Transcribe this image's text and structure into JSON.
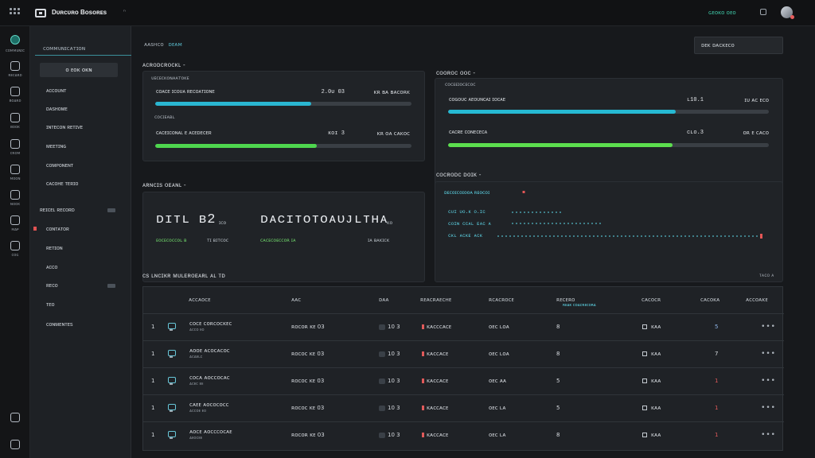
{
  "topbar": {
    "app_title": "Dᴜʀᴄᴜʀᴏ Bᴏsᴏʀᴇs",
    "badge": "ⁿ",
    "status": "ɢᴇᴏᴋᴏ ᴏᴇᴏ",
    "icons": [
      "grid-icon",
      "app-logo",
      "status-icon",
      "avatar"
    ]
  },
  "rail": {
    "items": [
      {
        "label": "ᴄᴏᴍᴍᴜɴɪᴄ",
        "icon": "activity-icon"
      },
      {
        "label": "ʀᴇᴄᴀʀᴅ",
        "icon": "circle-icon"
      },
      {
        "label": "ʙᴏᴀʀᴅ",
        "icon": "board-icon"
      },
      {
        "label": "ʙᴏᴏᴋ",
        "icon": "book-icon"
      },
      {
        "label": "ᴄʀᴏᴍ",
        "icon": "crown-icon"
      },
      {
        "label": "ᴍᴏᴏɴ",
        "icon": "moon-icon"
      },
      {
        "label": "ɴᴏᴏᴋ",
        "icon": "note-icon"
      },
      {
        "label": "ᴍᴀᴘ",
        "icon": "map-icon"
      },
      {
        "label": "ᴄᴏɢ",
        "icon": "gear-icon"
      }
    ],
    "bottom": [
      "terminal-icon",
      "settings-icon"
    ]
  },
  "sidebar": {
    "header": "ᴄᴏᴍᴍᴜɴɪᴄᴀᴛɪᴏɴ",
    "button": "ᴏ ᴇᴏᴋ ᴏᴋɴ",
    "items": [
      "ᴀᴄᴄᴏᴜɴᴛ",
      "ᴅᴀsʜᴏᴍᴇ",
      "ɪɴᴛᴇᴄᴏɴ ʀᴇᴛɪᴠᴇ",
      "ᴍᴇᴇᴛɪɴɢ",
      "ᴄᴏᴍᴘᴏɴᴇɴᴛ",
      "ᴄᴀᴄᴏʜᴇ ᴛᴇʀɪᴏ",
      "ʀᴇɪᴄᴇʟ ʀᴇᴄᴏʀᴅ",
      "ᴄᴏɴᴛᴀᴛᴏʀ",
      "ʀᴇᴛɪᴏɴ",
      "ᴀᴄᴄᴏ",
      "ʀᴇᴄᴏ",
      "ᴛᴇᴏ",
      "ᴄᴏɴᴍᴇɴᴛᴇs"
    ]
  },
  "main": {
    "breadcrumb": [
      "ᴀᴀsʜᴄᴏ",
      "ᴅᴇᴀᴍ"
    ],
    "top_select": "ᴅᴇᴋ ᴅᴀᴄᴋᴇᴄᴏ",
    "sections": {
      "left_title": "ᴀᴄʀᴏᴅᴄʀᴏᴄᴋʟ -",
      "right_title": "ᴄᴏᴏʀᴏᴄ ᴏᴏᴄ -",
      "middle_left_title": "ᴀʀɴᴄɪs ᴏᴇᴀɴʟ -",
      "middle_right_title": "ᴄᴏᴄʀᴏᴅᴄ ᴅᴏɪᴋ -",
      "table_title": "ᴄs ʟɴᴄɪᴋʀ ᴍᴜʟᴇʀᴏᴇᴀʀʟ ᴀʟ ᴛᴅ"
    },
    "left_panel": {
      "caption": "ᴜᴇᴄᴇᴄᴋᴏɴᴀᴀᴛᴏᴋᴇ",
      "bars": [
        {
          "label": "ᴄᴏᴀᴄᴇ ɪᴄᴏᴜᴀ ʀᴇᴄᴏᴀᴛɪᴏɴᴇ",
          "value": "2.0ᴜ 03",
          "unit": "ᴋʀ ʙᴀ ʙᴀᴄᴏʀᴋ",
          "progress": 0.61,
          "color": "#2ab6d1"
        },
        {
          "label": "ᴄᴀᴄᴇɪᴄᴏɴᴀʟ ᴇ ᴀᴄᴇᴅᴇᴄᴇʀ",
          "value": "ᴋᴏɪ 3",
          "unit": "ᴋʀ ᴏᴀ ᴄᴀᴋᴏᴄ",
          "progress": 0.63,
          "color": "#4ed64e"
        }
      ],
      "subcaption": "ᴄᴏᴄɪᴇᴀʙʟ"
    },
    "right_panel": {
      "caption": "ᴄᴏᴄᴇᴇɪᴏᴄᴇᴄᴏᴄ",
      "bars": [
        {
          "label": "ᴄᴏɢᴏᴜᴄ ᴀᴇᴏᴜɴᴄᴀɪ ɪᴏᴄᴀᴇ",
          "value": "ʟ10.1",
          "unit": "ɪᴜ ᴀᴄ ᴇᴄᴏ",
          "progress": 0.71,
          "color": "#26b9d3"
        },
        {
          "label": "ᴄᴀᴄʀᴇ ᴄᴏɴᴇᴄᴇᴄᴀ",
          "value": "ᴄʟᴏ.3",
          "unit": "ᴏʀ ᴇ ᴄᴀᴄᴏ",
          "progress": 0.7,
          "color": "#5cde4e"
        }
      ]
    },
    "middle_left_panel": {
      "metric_1": "ᴅɪᴛʟ ʙ2",
      "metric_1_unit": "ɪᴄᴏ",
      "metric_2": "ᴅᴀᴄɪᴛᴏᴛᴏᴀᴜᴊʟᴛʜᴀ",
      "metric_2_unit": "ᴋᴏ",
      "sub_1_label": "ᴇᴏᴄᴇᴄᴏᴄᴄᴏʟ ʙ",
      "sub_1_value": "ᴛɪ ʙɪᴛᴄᴏᴄ",
      "sub_2_label": "ᴄᴀᴄᴇᴄᴏᴇᴄᴄᴏʀ ɪᴀ",
      "sub_2_value": "ɪᴀ ʙᴀᴋɪᴄᴋ"
    },
    "middle_right_panel": {
      "title": "ᴅᴇᴄᴏɪᴄᴏɪᴏᴏᴀ ʀᴇᴏᴄᴏɪ",
      "lines": [
        "ᴄᴜɪ ᴜᴏ.ᴋ ᴏ.ɪᴄ",
        "ᴄᴏɪɴ ᴄᴄᴀʟ ᴇᴀᴄ ᴀ",
        "ᴄᴋʟ ᴀᴄᴋᴇ ᴀᴄᴋ"
      ],
      "spark_color": "#5ed8ea",
      "accent_color": "#e45656"
    },
    "table": {
      "title_right": "ᴛᴀᴄᴏ ᴀ",
      "headers": [
        "ᴀᴄᴄᴀᴏᴄᴇ",
        "ᴀᴀᴄ",
        "ᴅᴀᴀ",
        "ʀᴇᴀᴄʀᴀᴇᴄʜᴇ",
        "ʀᴄᴀᴄʀᴏᴄᴇ",
        "ʀᴇᴄᴇʀᴏ",
        "ᴄᴀᴄᴏᴄʀ",
        "ᴄᴀᴄᴏᴋᴀ",
        "ᴀᴄᴄᴏᴀᴋᴇ"
      ],
      "subheader": "ʀᴇᴀᴋ ᴄᴏᴀᴄʀᴇᴄᴏʀᴀ",
      "rows": [
        {
          "num": "1",
          "name": "ᴄᴏᴄᴇ ᴄᴏʀᴄᴏᴄᴋᴇᴄ",
          "name_sub": "ᴀᴄᴄᴏ ᴇᴏ",
          "col2": "ʀᴏᴄᴏʀ ᴋᴇ 03",
          "col3": "10 3",
          "col4": "ᴋᴀᴄᴄᴄᴀᴄᴇ",
          "col5": "ᴏᴇᴄ ʟᴏᴀ",
          "col6": "8",
          "col7": "ᴋᴀᴀ",
          "col8": "5",
          "col8_color": "#8fb5e8"
        },
        {
          "num": "1",
          "name": "ᴀᴏᴏᴇ ᴀᴄᴏᴄᴀᴄᴏᴄ",
          "name_sub": "ᴀᴄᴀᴇʟᴄ",
          "col2": "ʀᴏᴄᴏᴄ ᴋᴇ 03",
          "col3": "10 3",
          "col4": "ᴋᴀᴄᴄᴀᴄᴇ",
          "col5": "ᴏᴇᴄ ʟᴏᴀ",
          "col6": "8",
          "col7": "ᴋᴀᴀ",
          "col8": "7",
          "col8_color": "#d9dde1"
        },
        {
          "num": "1",
          "name": "ᴄᴏᴄᴀ ᴀᴏᴄᴄᴏᴄᴀᴄ",
          "name_sub": "ᴀᴄᴇᴄ ᴇᴇ",
          "col2": "ʀᴏᴄᴏᴄ ᴋᴇ 03",
          "col3": "10 3",
          "col4": "ᴋᴀᴄᴄᴀᴄᴇ",
          "col5": "ᴏᴇᴄ ᴀᴀ",
          "col6": "5",
          "col7": "ᴋᴀᴀ",
          "col8": "1",
          "col8_color": "#e05a5a"
        },
        {
          "num": "1",
          "name": "ᴄᴀᴇᴇ ᴀᴏᴄᴏᴄᴏᴄᴄ",
          "name_sub": "ᴀᴄᴄᴏᴇ ᴇᴏ",
          "col2": "ʀᴏᴄᴏᴄ ᴋᴇ 03",
          "col3": "10 3",
          "col4": "ᴋᴀᴄᴄᴀᴄᴇ",
          "col5": "ᴏᴇᴄ ʟᴀ",
          "col6": "5",
          "col7": "ᴋᴀᴀ",
          "col8": "1",
          "col8_color": "#e05a5a"
        },
        {
          "num": "1",
          "name": "ᴀᴏᴄᴇ ᴀᴏᴄᴄᴄᴏᴄᴀᴇ",
          "name_sub": "ᴀᴇᴏᴄᴇᴇ",
          "col2": "ʀᴏᴄᴏʀ ᴋᴇ 03",
          "col3": "10 3",
          "col4": "ᴋᴀᴄᴄᴀᴄᴇ",
          "col5": "ᴏᴇᴄ ʟᴀ",
          "col6": "8",
          "col7": "ᴋᴀᴀ",
          "col8": "1",
          "col8_color": "#e05a5a"
        }
      ]
    }
  }
}
